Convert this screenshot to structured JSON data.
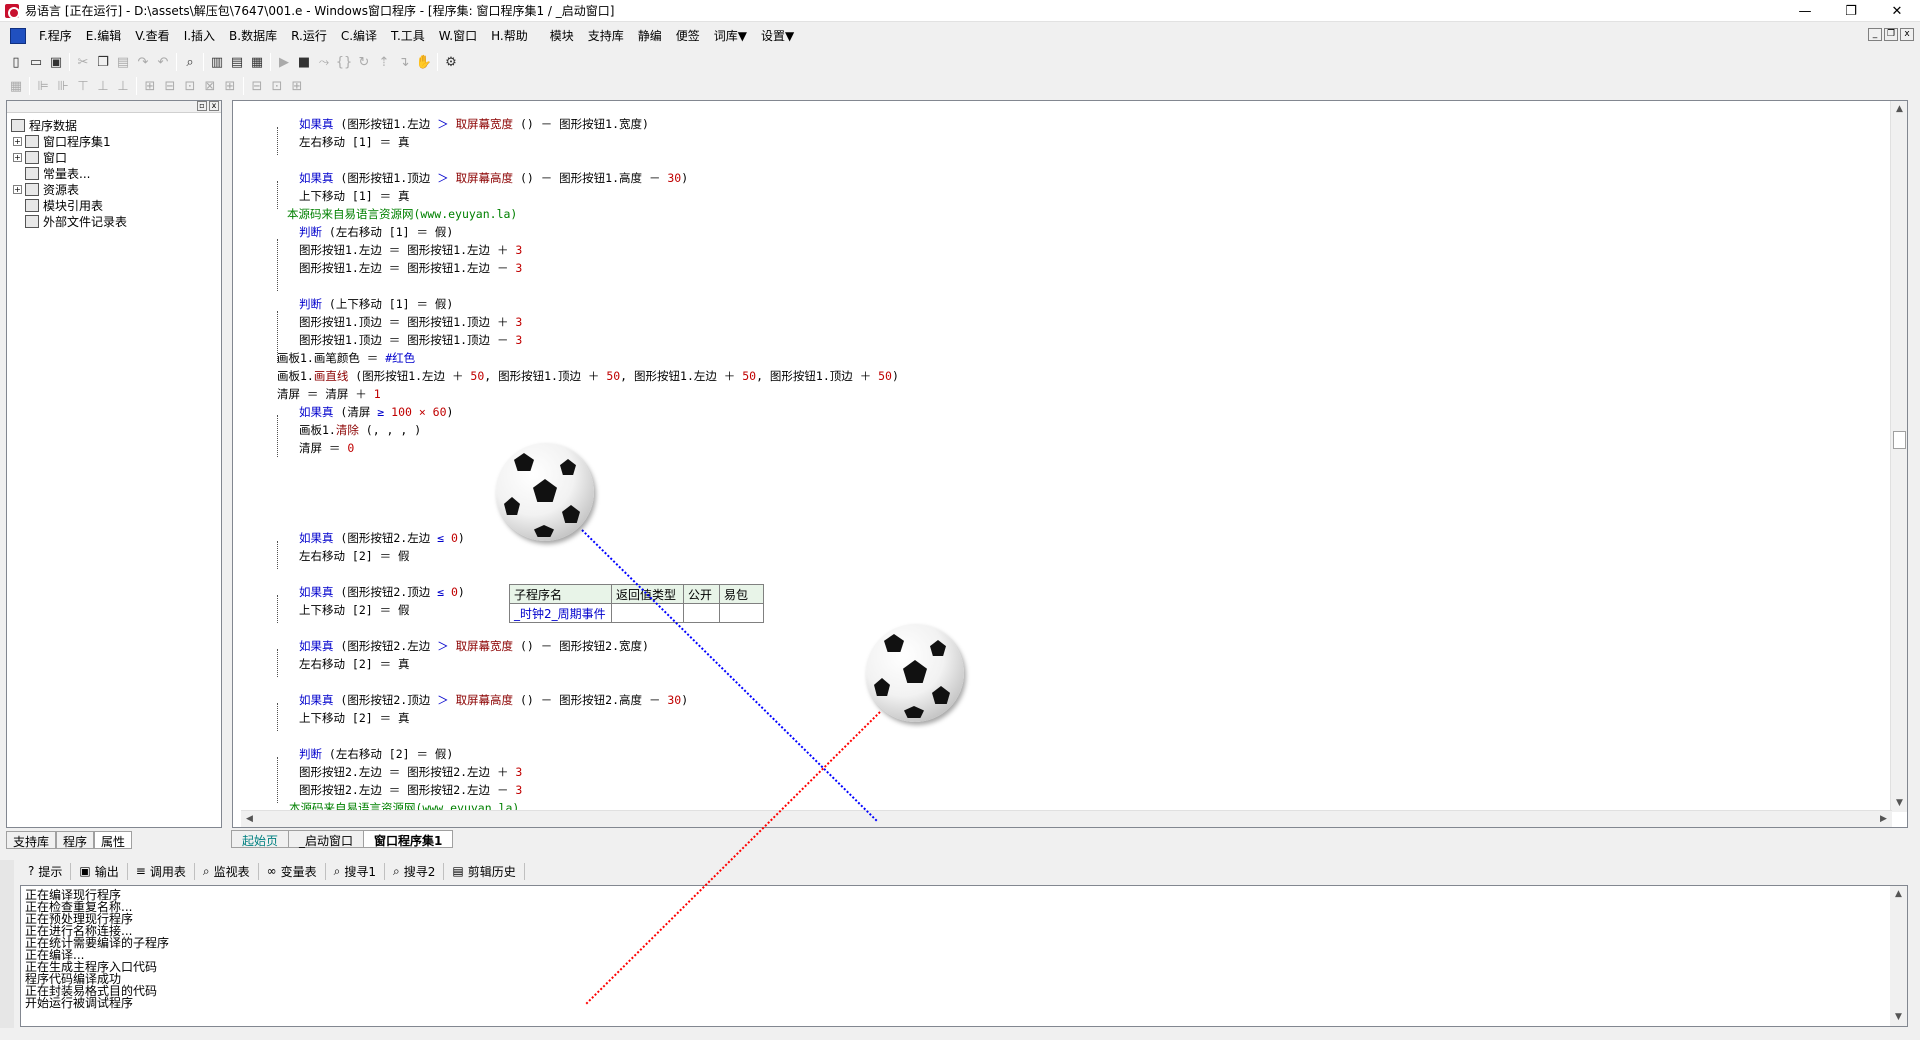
{
  "window": {
    "title": "易语言 [正在运行] - D:\\assets\\解压包\\7647\\001.e - Windows窗口程序 - [程序集: 窗口程序集1 / _启动窗口]",
    "minimize": "—",
    "maximize": "❐",
    "close": "✕"
  },
  "menu": {
    "items": [
      "F.程序",
      "E.编辑",
      "V.查看",
      "I.插入",
      "B.数据库",
      "R.运行",
      "C.编译",
      "T.工具",
      "W.窗口",
      "H.帮助"
    ],
    "extra": [
      "模块",
      "支持库",
      "静编",
      "便签",
      "词库▼",
      "设置▼"
    ]
  },
  "mdi": {
    "minimize": "_",
    "restore": "❐",
    "close": "x"
  },
  "tree": {
    "root": "程序数据",
    "items": [
      {
        "label": "窗口程序集1",
        "expand": "+",
        "level": 1
      },
      {
        "label": "窗口",
        "expand": "+",
        "level": 1
      },
      {
        "label": "常量表...",
        "expand": "",
        "level": 1
      },
      {
        "label": "资源表",
        "expand": "+",
        "level": 1
      },
      {
        "label": "模块引用表",
        "expand": "",
        "level": 1
      },
      {
        "label": "外部文件记录表",
        "expand": "",
        "level": 1
      }
    ]
  },
  "side_tabs": [
    "支持库",
    "程序",
    "属性"
  ],
  "code": {
    "l1": {
      "kw": "如果真",
      "a": " (图形按钮1.左边 ",
      "op": "＞",
      "fn": "取屏幕宽度",
      "b": " () － 图形按钮1.宽度)"
    },
    "l2": {
      "a": "左右移动 [1] ＝ 真"
    },
    "l3": {
      "kw": "如果真",
      "a": " (图形按钮1.顶边 ",
      "op": "＞",
      "fn": "取屏幕高度",
      "b": " () － 图形按钮1.高度 － ",
      "num": "30",
      "c": ")"
    },
    "l4": {
      "a": "上下移动 [1] ＝ 真"
    },
    "l5": {
      "cm": "本源码来自易语言资源网(www.eyuyan.la)"
    },
    "l6": {
      "kw": "判断",
      "a": " (左右移动 [1] ＝ 假)"
    },
    "l7": {
      "a": "图形按钮1.左边 ＝ 图形按钮1.左边 ＋ ",
      "num": "3"
    },
    "l8": {
      "a": "图形按钮1.左边 ＝ 图形按钮1.左边 － ",
      "num": "3"
    },
    "l9": {
      "kw": "判断",
      "a": " (上下移动 [1] ＝ 假)"
    },
    "l10": {
      "a": "图形按钮1.顶边 ＝ 图形按钮1.顶边 ＋ ",
      "num": "3"
    },
    "l11": {
      "a": "图形按钮1.顶边 ＝ 图形按钮1.顶边 － ",
      "num": "3"
    },
    "l12": {
      "a": "画板1.画笔颜色 ＝ ",
      "kw": "#红色"
    },
    "l13": {
      "a": "画板1.",
      "fn": "画直线",
      "b": " (图形按钮1.左边 ＋ ",
      "n1": "50",
      "c": ", 图形按钮1.顶边 ＋ ",
      "n2": "50",
      "d": ", 图形按钮1.左边 ＋ ",
      "n3": "50",
      "e": ", 图形按钮1.顶边 ＋ ",
      "n4": "50",
      "f": ")"
    },
    "l14": {
      "a": "清屏 ＝ 清屏 ＋ ",
      "num": "1"
    },
    "l15": {
      "kw": "如果真",
      "a": " (清屏 ",
      "op": "≥",
      "num": " 100 × 60",
      "b": ")"
    },
    "l16": {
      "a": "画板1.",
      "fn": "清除",
      "b": " (, , , )"
    },
    "l17": {
      "a": "清屏 ＝ ",
      "num": "0"
    },
    "sub_header": [
      "子程序名",
      "返回值类型",
      "公开",
      "易包"
    ],
    "sub_name": "_时钟2_周期事件",
    "l18": {
      "kw": "如果真",
      "a": " (图形按钮2.左边 ",
      "op": "≤",
      "num": " 0",
      "b": ")"
    },
    "l19": {
      "a": "左右移动 [2] ＝ 假"
    },
    "l20": {
      "kw": "如果真",
      "a": " (图形按钮2.顶边 ",
      "op": "≤",
      "num": " 0",
      "b": ")"
    },
    "l21": {
      "a": "上下移动 [2] ＝ 假"
    },
    "l22": {
      "kw": "如果真",
      "a": " (图形按钮2.左边 ",
      "op": "＞",
      "fn": "取屏幕宽度",
      "b": " () － 图形按钮2.宽度)"
    },
    "l23": {
      "a": "左右移动 [2] ＝ 真"
    },
    "l24": {
      "kw": "如果真",
      "a": " (图形按钮2.顶边 ",
      "op": "＞",
      "fn": "取屏幕高度",
      "b": " () － 图形按钮2.高度 － ",
      "num": "30",
      "c": ")"
    },
    "l25": {
      "a": "上下移动 [2] ＝ 真"
    },
    "l26": {
      "kw": "判断",
      "a": " (左右移动 [2] ＝ 假)"
    },
    "l27": {
      "a": "图形按钮2.左边 ＝ 图形按钮2.左边 ＋ ",
      "num": "3"
    },
    "l28": {
      "a": "图形按钮2.左边 ＝ 图形按钮2.左边 － ",
      "num": "3"
    },
    "l29": {
      "cm": "本源码来自易语言资源网(www.eyuyan.la)"
    }
  },
  "editor_tabs": [
    "起始页",
    "_启动窗口",
    "窗口程序集1"
  ],
  "output_tabs": [
    {
      "icon": "?",
      "label": "提示"
    },
    {
      "icon": "▣",
      "label": "输出"
    },
    {
      "icon": "≡",
      "label": "调用表"
    },
    {
      "icon": "⌕",
      "label": "监视表"
    },
    {
      "icon": "∞",
      "label": "变量表"
    },
    {
      "icon": "⌕",
      "label": "搜寻1"
    },
    {
      "icon": "⌕",
      "label": "搜寻2"
    },
    {
      "icon": "▤",
      "label": "剪辑历史"
    }
  ],
  "output_lines": [
    "正在编译现行程序",
    "正在检查重复名称...",
    "正在预处理现行程序",
    "正在进行名称连接...",
    "正在统计需要编译的子程序",
    "正在编译...",
    "正在生成主程序入口代码",
    "程序代码编译成功",
    "正在封装易格式目的代码",
    "开始运行被调试程序"
  ],
  "colors": {
    "keyword": "#0000cc",
    "function": "#8b0000",
    "number": "#c00000",
    "comment": "#008000",
    "blue_line": "#0000ff",
    "red_line": "#ff0000"
  },
  "icons": [
    "app-icon",
    "new-file-icon",
    "open-icon",
    "save-icon",
    "cut-icon",
    "copy-icon",
    "paste-icon",
    "redo-icon",
    "undo-icon",
    "find-icon",
    "run-icon",
    "stop-icon",
    "hand-icon",
    "soccer-ball"
  ]
}
